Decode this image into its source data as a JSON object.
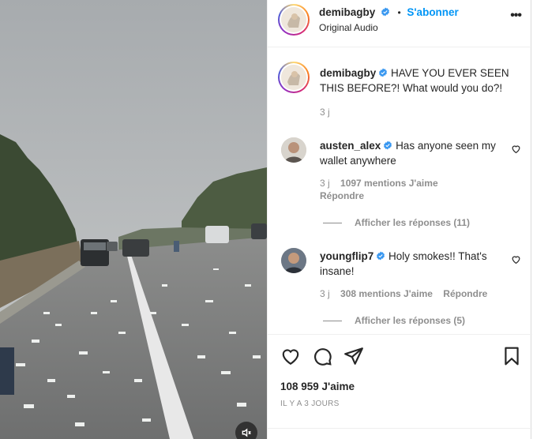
{
  "post": {
    "username": "demibagby",
    "follow_label": "S'abonner",
    "separator": "•",
    "audio": "Original Audio",
    "more_glyph": "•••"
  },
  "caption": {
    "username": "demibagby",
    "text": "HAVE YOU EVER SEEN THIS BEFORE?! What would you do?!",
    "time": "3 j"
  },
  "comments": [
    {
      "username": "austen_alex",
      "text": "Has anyone seen my wallet anywhere",
      "time": "3 j",
      "likes": "1097 mentions J'aime",
      "reply": "Répondre",
      "view_replies": "Afficher les réponses (11)"
    },
    {
      "username": "youngflip7",
      "text": "Holy smokes!! That's insane!",
      "time": "3 j",
      "likes": "308 mentions J'aime",
      "reply": "Répondre",
      "view_replies": "Afficher les réponses (5)"
    }
  ],
  "footer": {
    "likes": "108 959 J'aime",
    "date": "IL Y A 3 JOURS"
  },
  "colors": {
    "accent": "#0095f6",
    "verified": "#3897f0",
    "muted": "#8e8e8e"
  },
  "icons": [
    "more-options-icon",
    "verified-icon",
    "heart-icon",
    "comment-icon",
    "share-icon",
    "bookmark-icon",
    "mute-icon"
  ]
}
